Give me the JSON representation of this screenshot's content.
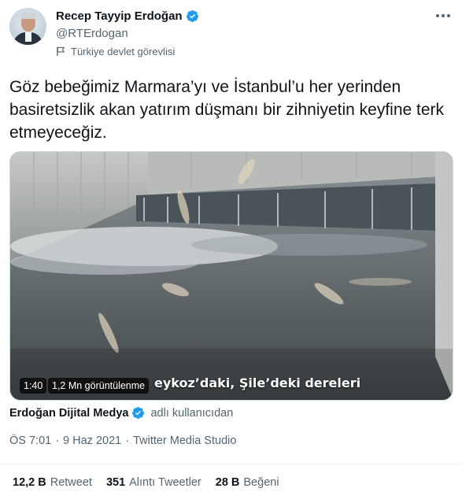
{
  "author": {
    "display_name": "Recep Tayyip Erdoğan",
    "handle": "@RTErdogan",
    "label": "Türkiye devlet görevlisi",
    "verified_icon": "verified-badge-icon",
    "accent": "#1d9bf0"
  },
  "tweet": {
    "text": "Göz bebeğimiz Marmara’yı ve İstanbul’u her yerinden basiretsizlik akan yatırım düşmanı bir zihniyetin keyfine terk etmeyeceğiz."
  },
  "video": {
    "caption": "eykoz’daki, Şile’deki dereleri",
    "duration": "1:40",
    "views": "1,2 Mn görüntülenme"
  },
  "source": {
    "name": "Erdoğan Dijital Medya",
    "suffix": "adlı kullanıcıdan"
  },
  "meta": {
    "time": "ÖS 7:01",
    "separator1": "·",
    "date": "9 Haz 2021",
    "separator2": "·",
    "client": "Twitter Media Studio"
  },
  "stats": [
    {
      "value": "12,2 B",
      "label": "Retweet"
    },
    {
      "value": "351",
      "label": "Alıntı Tweetler"
    },
    {
      "value": "28 B",
      "label": "Beğeni"
    }
  ]
}
